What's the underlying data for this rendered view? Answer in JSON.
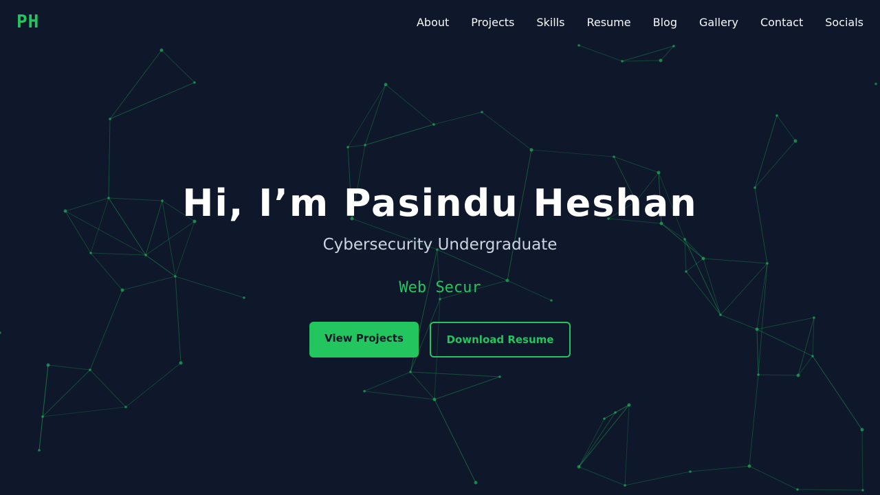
{
  "header": {
    "logo": "PH",
    "nav": [
      "About",
      "Projects",
      "Skills",
      "Resume",
      "Blog",
      "Gallery",
      "Contact",
      "Socials"
    ]
  },
  "hero": {
    "title": "Hi, I’m Pasindu Heshan",
    "subtitle": "Cybersecurity Undergraduate",
    "typing_text": "Web Secur",
    "primary_button": "View Projects",
    "secondary_button": "Download Resume"
  },
  "colors": {
    "background": "#0f172a",
    "accent": "#22c55e",
    "text": "#f8fafc",
    "muted": "#cbd5e1"
  }
}
